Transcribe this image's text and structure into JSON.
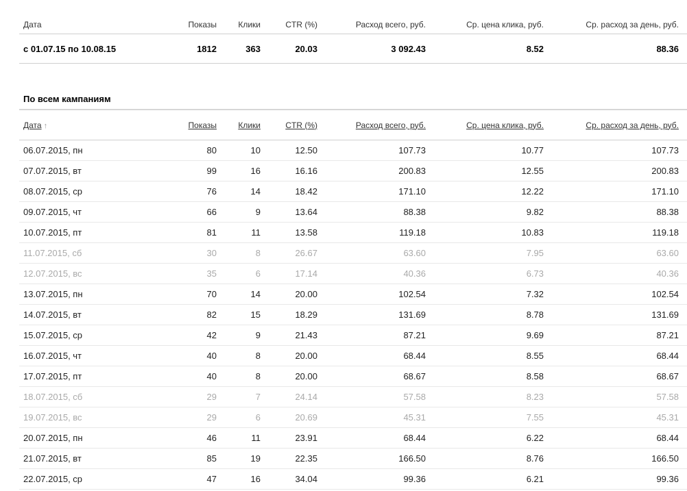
{
  "summary": {
    "headers": {
      "date": "Дата",
      "shows": "Показы",
      "clicks": "Клики",
      "ctr": "CTR (%)",
      "spend": "Расход всего, руб.",
      "cpc": "Ср. цена клика, руб.",
      "per_day": "Ср. расход за день, руб."
    },
    "values": {
      "date": "с 01.07.15 по 10.08.15",
      "shows": "1812",
      "clicks": "363",
      "ctr": "20.03",
      "spend": "3 092.43",
      "cpc": "8.52",
      "per_day": "88.36"
    }
  },
  "campaigns": {
    "title": "По всем кампаниям",
    "sort_arrow": "↑",
    "headers": {
      "date": "Дата",
      "shows": "Показы",
      "clicks": "Клики",
      "ctr": "CTR (%)",
      "spend": "Расход всего, руб.",
      "cpc": "Ср. цена клика, руб.",
      "per_day": "Ср. расход за день, руб."
    },
    "rows": [
      {
        "date": "06.07.2015, пн",
        "shows": "80",
        "clicks": "10",
        "ctr": "12.50",
        "spend": "107.73",
        "cpc": "10.77",
        "per_day": "107.73",
        "weekend": false
      },
      {
        "date": "07.07.2015, вт",
        "shows": "99",
        "clicks": "16",
        "ctr": "16.16",
        "spend": "200.83",
        "cpc": "12.55",
        "per_day": "200.83",
        "weekend": false
      },
      {
        "date": "08.07.2015, ср",
        "shows": "76",
        "clicks": "14",
        "ctr": "18.42",
        "spend": "171.10",
        "cpc": "12.22",
        "per_day": "171.10",
        "weekend": false
      },
      {
        "date": "09.07.2015, чт",
        "shows": "66",
        "clicks": "9",
        "ctr": "13.64",
        "spend": "88.38",
        "cpc": "9.82",
        "per_day": "88.38",
        "weekend": false
      },
      {
        "date": "10.07.2015, пт",
        "shows": "81",
        "clicks": "11",
        "ctr": "13.58",
        "spend": "119.18",
        "cpc": "10.83",
        "per_day": "119.18",
        "weekend": false
      },
      {
        "date": "11.07.2015, сб",
        "shows": "30",
        "clicks": "8",
        "ctr": "26.67",
        "spend": "63.60",
        "cpc": "7.95",
        "per_day": "63.60",
        "weekend": true
      },
      {
        "date": "12.07.2015, вс",
        "shows": "35",
        "clicks": "6",
        "ctr": "17.14",
        "spend": "40.36",
        "cpc": "6.73",
        "per_day": "40.36",
        "weekend": true
      },
      {
        "date": "13.07.2015, пн",
        "shows": "70",
        "clicks": "14",
        "ctr": "20.00",
        "spend": "102.54",
        "cpc": "7.32",
        "per_day": "102.54",
        "weekend": false
      },
      {
        "date": "14.07.2015, вт",
        "shows": "82",
        "clicks": "15",
        "ctr": "18.29",
        "spend": "131.69",
        "cpc": "8.78",
        "per_day": "131.69",
        "weekend": false
      },
      {
        "date": "15.07.2015, ср",
        "shows": "42",
        "clicks": "9",
        "ctr": "21.43",
        "spend": "87.21",
        "cpc": "9.69",
        "per_day": "87.21",
        "weekend": false
      },
      {
        "date": "16.07.2015, чт",
        "shows": "40",
        "clicks": "8",
        "ctr": "20.00",
        "spend": "68.44",
        "cpc": "8.55",
        "per_day": "68.44",
        "weekend": false
      },
      {
        "date": "17.07.2015, пт",
        "shows": "40",
        "clicks": "8",
        "ctr": "20.00",
        "spend": "68.67",
        "cpc": "8.58",
        "per_day": "68.67",
        "weekend": false
      },
      {
        "date": "18.07.2015, сб",
        "shows": "29",
        "clicks": "7",
        "ctr": "24.14",
        "spend": "57.58",
        "cpc": "8.23",
        "per_day": "57.58",
        "weekend": true
      },
      {
        "date": "19.07.2015, вс",
        "shows": "29",
        "clicks": "6",
        "ctr": "20.69",
        "spend": "45.31",
        "cpc": "7.55",
        "per_day": "45.31",
        "weekend": true
      },
      {
        "date": "20.07.2015, пн",
        "shows": "46",
        "clicks": "11",
        "ctr": "23.91",
        "spend": "68.44",
        "cpc": "6.22",
        "per_day": "68.44",
        "weekend": false
      },
      {
        "date": "21.07.2015, вт",
        "shows": "85",
        "clicks": "19",
        "ctr": "22.35",
        "spend": "166.50",
        "cpc": "8.76",
        "per_day": "166.50",
        "weekend": false
      },
      {
        "date": "22.07.2015, ср",
        "shows": "47",
        "clicks": "16",
        "ctr": "34.04",
        "spend": "99.36",
        "cpc": "6.21",
        "per_day": "99.36",
        "weekend": false
      }
    ]
  }
}
